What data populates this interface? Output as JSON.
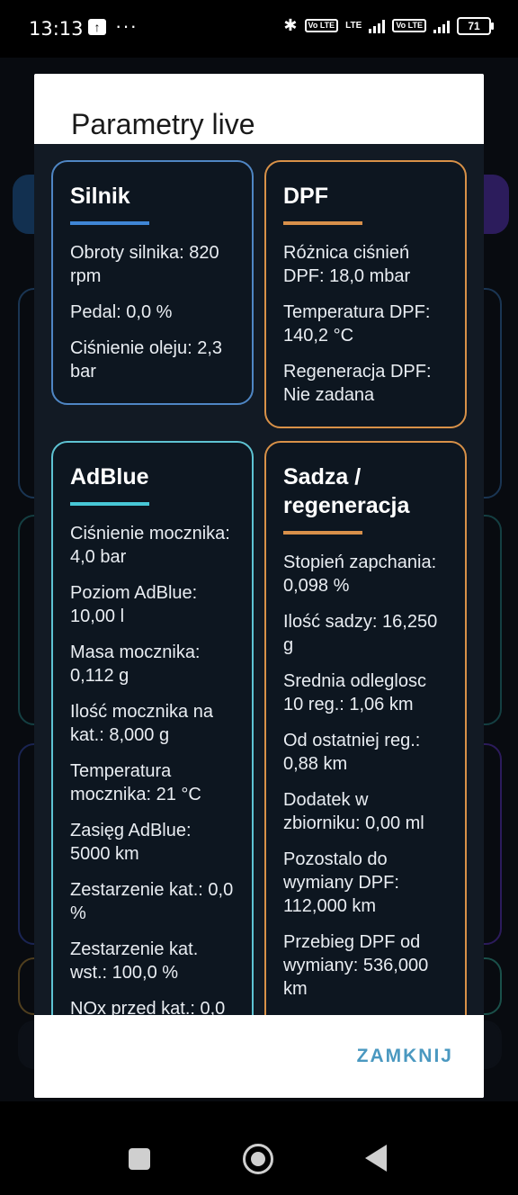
{
  "status_bar": {
    "time": "13:13",
    "more_indicator": "···",
    "volte_label": "Vo LTE",
    "lte_label": "LTE",
    "battery": "71"
  },
  "dialog": {
    "title": "Parametry live",
    "close_label": "ZAMKNIJ",
    "cards": {
      "silnik": {
        "title": "Silnik",
        "params": [
          "Obroty silnika: 820 rpm",
          "Pedal: 0,0 %",
          "Ciśnienie oleju: 2,3 bar"
        ]
      },
      "dpf": {
        "title": "DPF",
        "params": [
          "Różnica ciśnień DPF: 18,0 mbar",
          "Temperatura DPF: 140,2 °C",
          "Regeneracja DPF: Nie zadana"
        ]
      },
      "adblue": {
        "title": "AdBlue",
        "params": [
          "Ciśnienie mocznika: 4,0 bar",
          "Poziom AdBlue: 10,00 l",
          "Masa mocznika: 0,112 g",
          "Ilość mocznika na kat.: 8,000 g",
          "Temperatura mocznika: 21 °C",
          "Zasięg AdBlue: 5000 km",
          "Zestarzenie kat.: 0,0 %",
          "Zestarzenie kat. wst.: 100,0 %",
          "NOx przed kat.: 0,0"
        ]
      },
      "sadza": {
        "title": "Sadza / regeneracja",
        "params": [
          "Stopień zapchania: 0,098 %",
          "Ilość sadzy: 16,250 g",
          "Srednia odleglosc 10 reg.: 1,06 km",
          "Od ostatniej reg.: 0,88 km",
          "Dodatek w zbiorniku: 0,00 ml",
          "Pozostalo do wymiany DPF: 112,000 km",
          "Przebieg DPF od wymiany: 536,000 km"
        ]
      }
    }
  },
  "colors": {
    "blue_accent": "#3f86d6",
    "orange_accent": "#d8904a",
    "cyan_accent": "#47c7d6",
    "close_button": "#4a98c0"
  }
}
